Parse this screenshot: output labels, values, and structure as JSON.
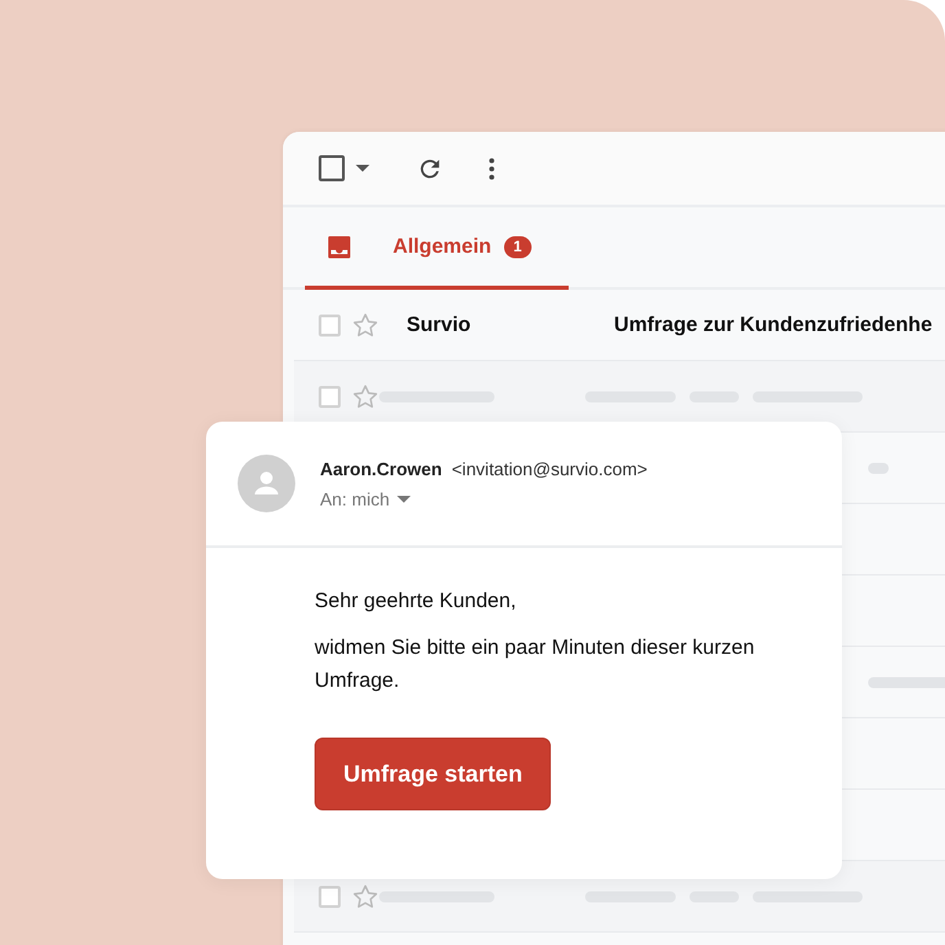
{
  "toolbar": {
    "select_all_checked": false
  },
  "tabs": [
    {
      "label": "Allgemein",
      "badge": "1",
      "selected": true
    }
  ],
  "rows": [
    {
      "kind": "message",
      "checked": false,
      "starred": false,
      "sender": "Survio",
      "subject": "Umfrage zur Kundenzufriedenhe"
    },
    {
      "kind": "placeholder",
      "checked": false,
      "starred": false
    },
    {
      "kind": "stub"
    },
    {
      "kind": "covered"
    },
    {
      "kind": "covered"
    },
    {
      "kind": "peek"
    },
    {
      "kind": "covered"
    },
    {
      "kind": "covered"
    },
    {
      "kind": "placeholder",
      "checked": false,
      "starred": false
    }
  ],
  "message": {
    "sender": "Aaron.Crowen",
    "email": "<invitation@survio.com>",
    "recipient": "An: mich",
    "greeting": "Sehr geehrte Kunden,",
    "body": "widmen Sie bitte ein paar Minuten dieser kurzen Umfrage.",
    "button": "Umfrage starten"
  }
}
